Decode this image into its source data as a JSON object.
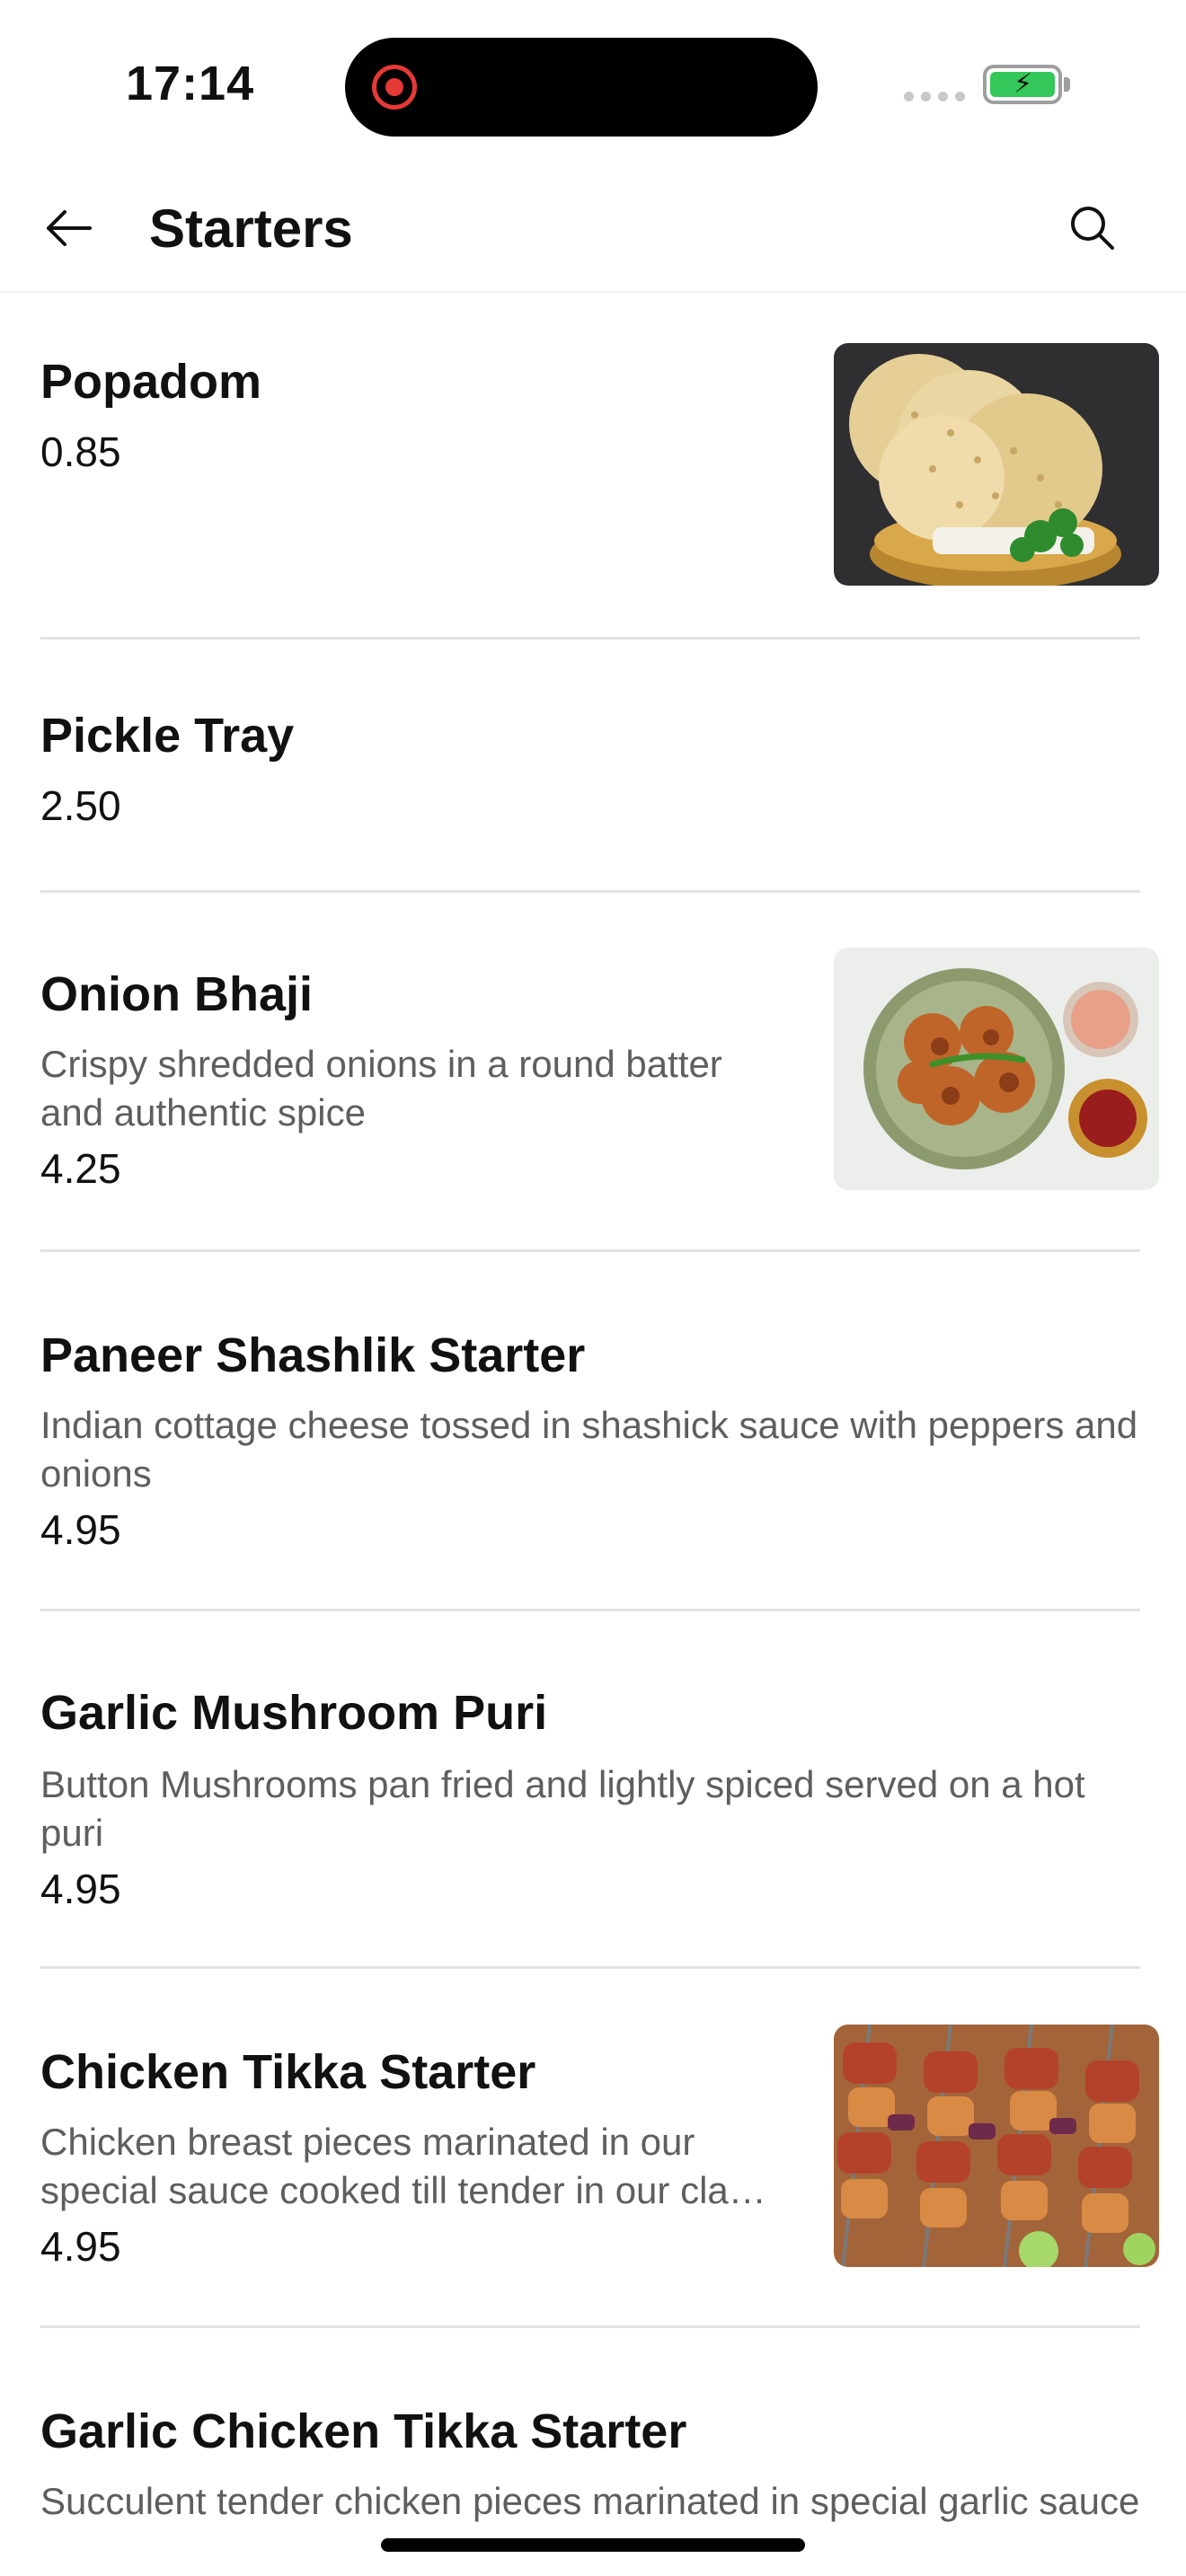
{
  "status_bar": {
    "time": "17:14"
  },
  "header": {
    "title": "Starters",
    "back_icon": "arrow-left-icon",
    "search_icon": "search-icon"
  },
  "items": [
    {
      "name": "Popadom",
      "description": "",
      "price": "0.85",
      "image": "popadom-photo"
    },
    {
      "name": "Pickle Tray",
      "description": "",
      "price": "2.50",
      "image": ""
    },
    {
      "name": "Onion Bhaji",
      "description": "Crispy shredded onions in a round batter and authentic spice",
      "price": "4.25",
      "image": "onion-bhaji-photo"
    },
    {
      "name": "Paneer Shashlik Starter",
      "description": "Indian cottage cheese tossed in shashick sauce with peppers and onions",
      "price": "4.95",
      "image": ""
    },
    {
      "name": "Garlic Mushroom Puri",
      "description": "Button Mushrooms pan fried and lightly spiced served on a hot puri",
      "price": "4.95",
      "image": ""
    },
    {
      "name": "Chicken Tikka Starter",
      "description": "Chicken breast pieces marinated in our special sauce cooked till tender in our cla…",
      "price": "4.95",
      "image": "chicken-tikka-photo"
    },
    {
      "name": "Garlic Chicken Tikka Starter",
      "description": "Succulent tender chicken pieces marinated in special garlic sauce",
      "price": "",
      "image": ""
    }
  ],
  "colors": {
    "battery_fill": "#34c759",
    "recording": "#e53935",
    "description_text": "#5e5e5e",
    "divider": "#e3e3e3"
  }
}
